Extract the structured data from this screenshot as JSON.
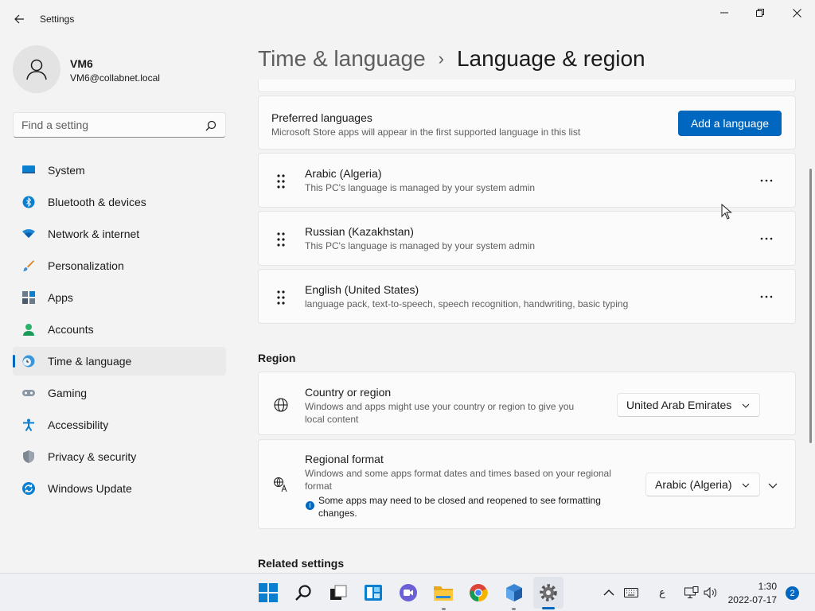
{
  "window": {
    "title": "Settings"
  },
  "user": {
    "name": "VM6",
    "email": "VM6@collabnet.local"
  },
  "search": {
    "placeholder": "Find a setting"
  },
  "sidebar": {
    "items": [
      {
        "label": "System",
        "icon": "monitor-icon"
      },
      {
        "label": "Bluetooth & devices",
        "icon": "bluetooth-icon"
      },
      {
        "label": "Network & internet",
        "icon": "wifi-icon"
      },
      {
        "label": "Personalization",
        "icon": "brush-icon"
      },
      {
        "label": "Apps",
        "icon": "apps-icon"
      },
      {
        "label": "Accounts",
        "icon": "person-icon"
      },
      {
        "label": "Time & language",
        "icon": "clock-globe-icon",
        "active": true
      },
      {
        "label": "Gaming",
        "icon": "gamepad-icon"
      },
      {
        "label": "Accessibility",
        "icon": "accessibility-icon"
      },
      {
        "label": "Privacy & security",
        "icon": "shield-icon"
      },
      {
        "label": "Windows Update",
        "icon": "refresh-icon"
      }
    ]
  },
  "header": {
    "parent": "Time & language",
    "separator": "›",
    "current": "Language & region"
  },
  "preferred": {
    "title": "Preferred languages",
    "subtitle": "Microsoft Store apps will appear in the first supported language in this list",
    "button": "Add a language"
  },
  "languages": [
    {
      "name": "Arabic (Algeria)",
      "detail": "This PC's language is managed by your system admin"
    },
    {
      "name": "Russian (Kazakhstan)",
      "detail": "This PC's language is managed by your system admin"
    },
    {
      "name": "English (United States)",
      "detail": "language pack, text-to-speech, speech recognition, handwriting, basic typing"
    }
  ],
  "region": {
    "section_title": "Region",
    "country": {
      "title": "Country or region",
      "subtitle_line1": "Windows and apps might use your country or region to give you",
      "subtitle_line2": "local content",
      "value": "United Arab Emirates"
    },
    "format": {
      "title": "Regional format",
      "subtitle_line1": "Windows and some apps format dates and times based on your regional",
      "subtitle_line2": "format",
      "info_line1": "Some apps may need to be closed and reopened to see formatting",
      "info_line2": "changes.",
      "value": "Arabic (Algeria)"
    }
  },
  "related": {
    "title": "Related settings"
  },
  "taskbar": {
    "time": "1:30",
    "date": "2022-07-17",
    "input_indicator": "ع",
    "notification_count": "2"
  },
  "colors": {
    "accent": "#0067c0"
  }
}
